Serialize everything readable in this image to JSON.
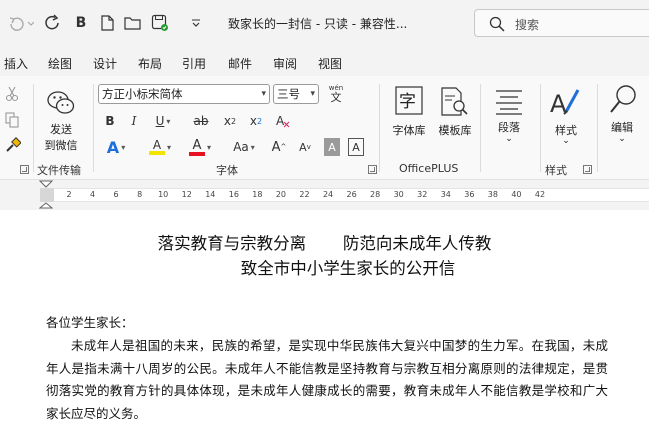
{
  "title_bar": {
    "document_title": "致家长的一封信 - 只读 - 兼容性...",
    "search_placeholder": "搜索",
    "quick_access": [
      "undo-icon",
      "redo-icon",
      "bold-b-icon",
      "new-file-icon",
      "open-folder-icon",
      "save-icon",
      "customize-icon"
    ]
  },
  "tabs": [
    "插入",
    "绘图",
    "设计",
    "布局",
    "引用",
    "邮件",
    "审阅",
    "视图"
  ],
  "ribbon": {
    "wechat": {
      "label_line1": "发送",
      "label_line2": "到微信",
      "group": "文件传输"
    },
    "font": {
      "name": "方正小标宋简体",
      "size": "三号",
      "phonetic_top": "wén",
      "phonetic_bottom": "文",
      "group": "字体",
      "bold": "B",
      "italic": "I",
      "underline": "U",
      "strikethrough": "ab",
      "subscript": "x",
      "subscript_mark": "2",
      "superscript": "x",
      "superscript_mark": "2",
      "text_effects": "A",
      "highlight": "A",
      "font_color": "A",
      "change_case": "Aa",
      "grow": "A",
      "shrink": "A",
      "char_shading": "A",
      "char_border": "A",
      "colors": {
        "highlight": "#f5e400",
        "font_color": "#e81123",
        "effects": "#1e6fd9"
      }
    },
    "officeplus": {
      "font_library": "字体库",
      "template_library": "模板库",
      "group": "OfficePLUS"
    },
    "paragraph": {
      "label": "段落"
    },
    "styles": {
      "label": "样式",
      "group": "样式"
    },
    "editing": {
      "label": "编辑"
    }
  },
  "ruler": {
    "ticks": [
      "2",
      "4",
      "6",
      "8",
      "10",
      "12",
      "14",
      "16",
      "18",
      "20",
      "22",
      "24",
      "26",
      "28",
      "30",
      "32",
      "34",
      "36",
      "38",
      "40",
      "42"
    ]
  },
  "document": {
    "title_line1_a": "落实教育与宗教分离",
    "title_line1_b": "防范向未成年人传教",
    "title_line2": "致全市中小学生家长的公开信",
    "greeting": "各位学生家长：",
    "paragraph": "未成年人是祖国的未来，民族的希望，是实现中华民族伟大复兴中国梦的生力军。在我国，未成年人是指未满十八周岁的公民。未成年人不能信教是坚持教育与宗教互相分离原则的法律规定，是贯彻落实党的教育方针的具体体现，是未成年人健康成长的需要，教育未成年人不能信教是学校和广大家长应尽的义务。"
  }
}
